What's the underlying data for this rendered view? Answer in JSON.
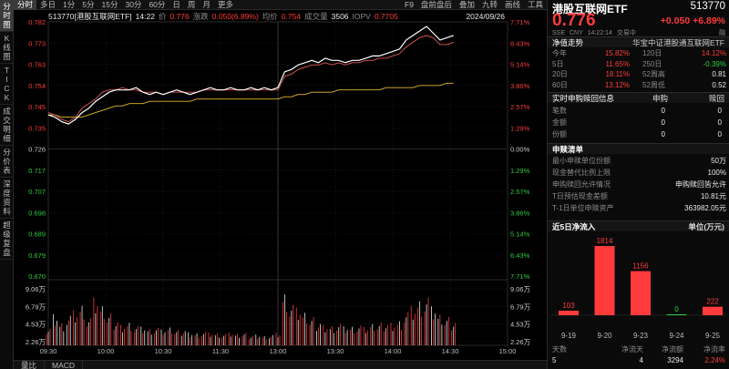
{
  "sidebar": {
    "tabs": [
      {
        "label": "分时图",
        "active": true
      },
      {
        "label": "K线图",
        "active": false
      },
      {
        "label": "TICK",
        "active": false
      },
      {
        "label": "成交明细",
        "active": false
      },
      {
        "label": "分价表",
        "active": false
      },
      {
        "label": "深度资料",
        "active": false
      },
      {
        "label": "超级复盘",
        "active": false
      }
    ]
  },
  "toolbar": {
    "periods": [
      {
        "label": "分时",
        "active": true
      },
      {
        "label": "多日"
      },
      {
        "label": "1分"
      },
      {
        "label": "5分"
      },
      {
        "label": "15分"
      },
      {
        "label": "30分"
      },
      {
        "label": "60分"
      },
      {
        "label": "日"
      },
      {
        "label": "周"
      },
      {
        "label": "月"
      },
      {
        "label": "更多"
      }
    ],
    "right_items": [
      "F9",
      "盘前盘后",
      "叠加",
      "九转",
      "画线",
      "工具"
    ]
  },
  "infoline": {
    "code_name": "513770[港股互联网ETF]",
    "time": "14:22",
    "price_label": "价",
    "price": "0.776",
    "change_label": "涨跌",
    "change": "0.050(6.89%)",
    "avg_label": "均价",
    "avg": "0.754",
    "vol_label": "成交量",
    "vol": "3506",
    "iopv_label": "IOPV",
    "iopv": "0.7705",
    "date": "2024/09/26"
  },
  "chart_data": {
    "type": "line",
    "price_axis": {
      "ticks": [
        "0.782",
        "0.773",
        "0.763",
        "0.754",
        "0.745",
        "0.735",
        "0.726",
        "0.717",
        "0.707",
        "0.698",
        "0.689",
        "0.679",
        "0.670"
      ],
      "pct": [
        "7.71%",
        "6.43%",
        "5.14%",
        "3.86%",
        "2.57%",
        "1.29%",
        "0.00%",
        "1.29%",
        "2.57%",
        "3.86%",
        "5.14%",
        "6.43%",
        "7.71%"
      ],
      "ylim": [
        0.67,
        0.782
      ],
      "prev_close": 0.726
    },
    "volume_axis": {
      "ticks": [
        "9.06万",
        "6.79万",
        "4.53万",
        "2.26万"
      ],
      "ylim": [
        0,
        100000
      ]
    },
    "time_axis": {
      "ticks": [
        "09:30",
        "10:00",
        "10:30",
        "11:30",
        "13:00",
        "13:30",
        "14:00",
        "14:30",
        "15:00"
      ]
    },
    "series": [
      {
        "name": "价",
        "color": "#ffffff",
        "values": [
          0.741,
          0.74,
          0.738,
          0.737,
          0.739,
          0.742,
          0.744,
          0.747,
          0.749,
          0.751,
          0.752,
          0.752,
          0.752,
          0.753,
          0.751,
          0.75,
          0.751,
          0.75,
          0.751,
          0.752,
          0.751,
          0.75,
          0.751,
          0.752,
          0.753,
          0.752,
          0.752,
          0.753,
          0.752,
          0.752,
          0.753,
          0.752,
          0.753,
          0.752,
          0.753,
          0.76,
          0.761,
          0.763,
          0.764,
          0.765,
          0.764,
          0.766,
          0.765,
          0.765,
          0.764,
          0.765,
          0.765,
          0.766,
          0.767,
          0.767,
          0.768,
          0.769,
          0.77,
          0.774,
          0.776,
          0.778,
          0.78,
          0.777,
          0.774,
          0.775,
          0.776
        ]
      },
      {
        "name": "IOPV",
        "color": "#e05a5a",
        "values": [
          0.742,
          0.741,
          0.739,
          0.738,
          0.74,
          0.744,
          0.746,
          0.748,
          0.751,
          0.752,
          0.752,
          0.753,
          0.752,
          0.752,
          0.751,
          0.751,
          0.751,
          0.75,
          0.751,
          0.751,
          0.751,
          0.751,
          0.751,
          0.752,
          0.752,
          0.752,
          0.752,
          0.752,
          0.752,
          0.752,
          0.752,
          0.752,
          0.752,
          0.752,
          0.752,
          0.758,
          0.759,
          0.761,
          0.762,
          0.763,
          0.763,
          0.764,
          0.763,
          0.764,
          0.763,
          0.764,
          0.764,
          0.765,
          0.765,
          0.766,
          0.766,
          0.767,
          0.768,
          0.771,
          0.773,
          0.775,
          0.776,
          0.775,
          0.772,
          0.772,
          0.773
        ]
      },
      {
        "name": "均价",
        "color": "#e5b82a",
        "values": [
          0.741,
          0.741,
          0.74,
          0.74,
          0.74,
          0.74,
          0.741,
          0.742,
          0.743,
          0.744,
          0.745,
          0.745,
          0.746,
          0.746,
          0.746,
          0.747,
          0.747,
          0.747,
          0.747,
          0.747,
          0.747,
          0.747,
          0.748,
          0.748,
          0.748,
          0.748,
          0.748,
          0.748,
          0.748,
          0.748,
          0.748,
          0.748,
          0.748,
          0.748,
          0.748,
          0.749,
          0.749,
          0.75,
          0.75,
          0.751,
          0.751,
          0.751,
          0.751,
          0.752,
          0.752,
          0.752,
          0.752,
          0.752,
          0.752,
          0.752,
          0.753,
          0.753,
          0.753,
          0.753,
          0.753,
          0.754,
          0.754,
          0.754,
          0.754,
          0.755,
          0.755
        ]
      }
    ],
    "volume": [
      32000,
      58000,
      41000,
      55000,
      62000,
      70000,
      48000,
      81000,
      66000,
      54000,
      45000,
      38000,
      42000,
      36000,
      33000,
      29000,
      31000,
      27000,
      30000,
      26000,
      28000,
      24000,
      22000,
      25000,
      23000,
      21000,
      20000,
      22000,
      19000,
      21000,
      18000,
      20000,
      17000,
      19000,
      22000,
      90000,
      72000,
      64000,
      55000,
      48000,
      42000,
      38000,
      36000,
      40000,
      34000,
      33000,
      35000,
      31000,
      36000,
      38000,
      40000,
      42000,
      45000,
      62000,
      70000,
      78000,
      85000,
      66000,
      52000,
      48000,
      44000
    ]
  },
  "right_panel": {
    "title": "港股互联网ETF",
    "code": "513770",
    "price": "0.776",
    "change": "+0.050",
    "change_pct": "+6.89%",
    "sub": [
      "SSE",
      "CNY",
      "14:22:14",
      "交易中"
    ],
    "sub_badge": "融",
    "trend_head": "净值走势",
    "trend_index": "华宝中证港股通互联网ETF",
    "trend_rows": [
      {
        "l1": "今年",
        "v1": "15.82%",
        "l2": "120日",
        "v2": "14.12%",
        "c2": "red"
      },
      {
        "l1": "5日",
        "v1": "11.65%",
        "l2": "250日",
        "v2": "-0.39%",
        "c2": "green"
      },
      {
        "l1": "20日",
        "v1": "18.11%",
        "l2": "52周高",
        "v2": "0.81",
        "c2": "white"
      },
      {
        "l1": "60日",
        "v1": "13.12%",
        "l2": "52周低",
        "v2": "0.52",
        "c2": "white"
      }
    ],
    "realtime_head": "实时申购赎回信息",
    "realtime_cols": [
      "申购",
      "赎回"
    ],
    "realtime_rows": [
      {
        "label": "笔数",
        "a": "0",
        "b": "0"
      },
      {
        "label": "金额",
        "a": "0",
        "b": "0"
      },
      {
        "label": "份额",
        "a": "0",
        "b": "0"
      }
    ],
    "list_head": "申赎清单",
    "list_rows": [
      {
        "label": "最小申赎单位份额",
        "value": "50万"
      },
      {
        "label": "现金替代比例上限",
        "value": "100%"
      },
      {
        "label": "申购赎回允许情况",
        "value": "申购赎回皆允许"
      },
      {
        "label": "T日预估现金差额",
        "value": "10.81元"
      },
      {
        "label": "T-1日单位申赎资产",
        "value": "363982.05元"
      }
    ],
    "flow_head": "近5日净流入",
    "flow_unit": "单位(万元)",
    "flow_chart": {
      "type": "bar",
      "categories": [
        "9-19",
        "9-20",
        "9-23",
        "9-24",
        "9-25"
      ],
      "values": [
        103,
        1814,
        1156,
        0,
        222
      ]
    },
    "flow_table": {
      "headers": [
        "天数",
        "净流天",
        "净流额",
        "净流率"
      ],
      "values": [
        "5",
        "4",
        "3294",
        "2.24%"
      ]
    }
  },
  "bottombar": {
    "tabs": [
      "量比",
      "MACD"
    ]
  }
}
